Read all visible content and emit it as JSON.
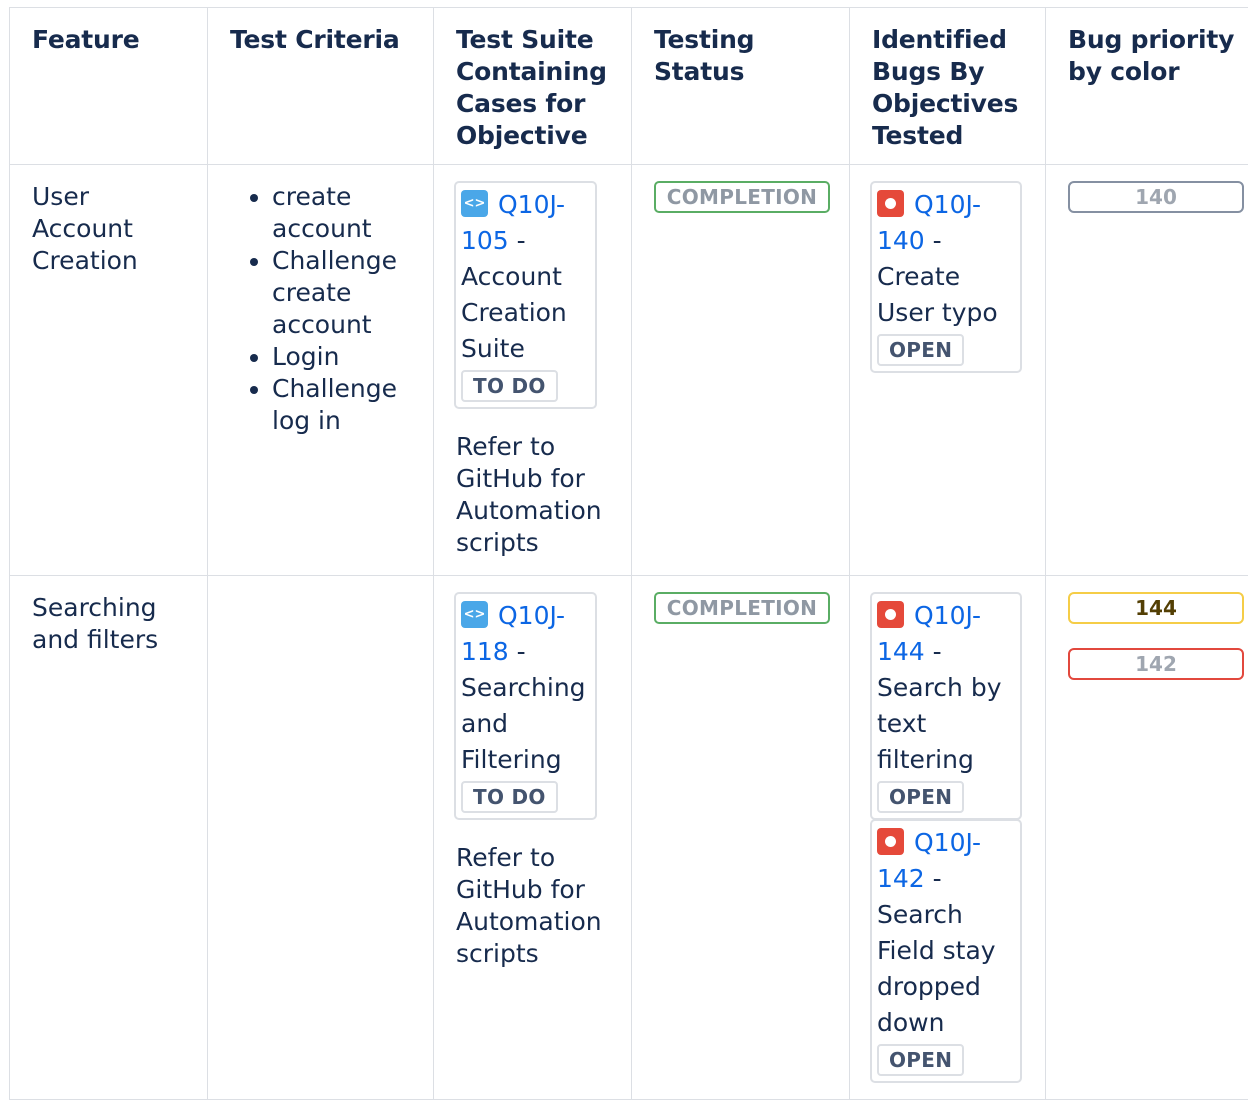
{
  "headers": {
    "feature": "Feature",
    "criteria": "Test Criteria",
    "suite": "Test Suite Containing Cases for Objective",
    "status": "Testing Status",
    "bugs": "Identified Bugs By Objectives Tested",
    "priority": "Bug priority by color"
  },
  "rows": [
    {
      "feature": "User Account Creation",
      "criteria": [
        "create account",
        "Challenge create account",
        "Login",
        "Challenge log in"
      ],
      "suite": {
        "key": "Q10J-105",
        "sep": " - ",
        "title": "Account Creation Suite",
        "status": "TO DO",
        "icon": "test-suite-icon"
      },
      "note": "Refer to GitHub for Automation scripts",
      "testing_status": "COMPLETION",
      "bugs": [
        {
          "key": "Q10J-140",
          "sep": " - ",
          "title": "Create User typo",
          "status": "OPEN",
          "icon": "bug-icon"
        }
      ],
      "priorities": [
        {
          "label": "140",
          "color": "#8590a2",
          "text_color": "#9fa6b0"
        }
      ]
    },
    {
      "feature": "Searching and filters",
      "criteria": [],
      "suite": {
        "key": "Q10J-118",
        "sep": " - ",
        "title": "Searching and Filtering",
        "status": "TO DO",
        "icon": "test-suite-icon"
      },
      "note": "Refer to GitHub for Automation scripts",
      "testing_status": "COMPLETION",
      "bugs": [
        {
          "key": "Q10J-144",
          "sep": " - ",
          "title": "Search by text filtering",
          "status": "OPEN",
          "icon": "bug-icon"
        },
        {
          "key": "Q10J-142",
          "sep": " - ",
          "title": "Search Field stay dropped down",
          "status": "OPEN",
          "icon": "bug-icon"
        }
      ],
      "priorities": [
        {
          "label": "144",
          "color": "#f5cd47",
          "text_color": "#533f04"
        },
        {
          "label": "142",
          "color": "#e2483d",
          "text_color": "#9fa6b0"
        }
      ]
    }
  ],
  "colors": {
    "status_border": "#5aad64",
    "link": "#0c66e4",
    "text": "#172b4d"
  }
}
